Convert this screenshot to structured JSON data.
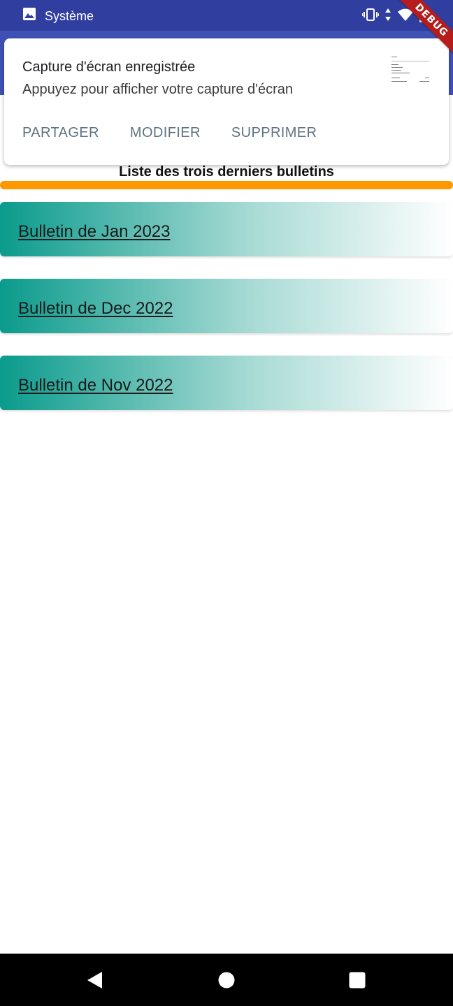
{
  "status_bar": {
    "app_label": "Système"
  },
  "debug_banner": "DEBUG",
  "notification": {
    "title": "Capture d'écran enregistrée",
    "text": "Appuyez pour afficher votre capture d'écran",
    "actions": [
      "PARTAGER",
      "MODIFIER",
      "SUPPRIMER"
    ]
  },
  "main": {
    "heading": "Liste des trois derniers bulletins",
    "bulletins": [
      {
        "label": "Bulletin de Jan 2023"
      },
      {
        "label": "Bulletin de Dec 2022"
      },
      {
        "label": "Bulletin de Nov 2022"
      }
    ]
  },
  "colors": {
    "status_bar": "#303F9F",
    "app_bar": "#3F51B5",
    "divider": "#FF9800",
    "card_start": "#0a9b8c",
    "action_text": "#5f7383"
  },
  "icons": {
    "status_app": "image-icon",
    "vibrate": "vibrate-icon",
    "data": "data-arrows-icon",
    "wifi": "wifi-icon",
    "battery": "battery-icon",
    "nav_back": "back-triangle-icon",
    "nav_home": "home-circle-icon",
    "nav_recents": "recents-square-icon"
  }
}
